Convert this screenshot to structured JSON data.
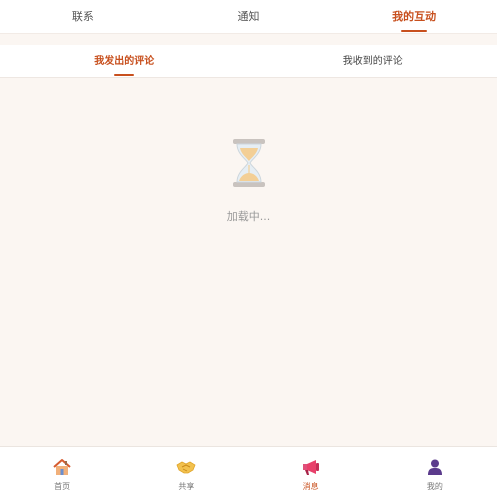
{
  "top_tabs": [
    {
      "label": "联系"
    },
    {
      "label": "通知"
    },
    {
      "label": "我的互动"
    }
  ],
  "sub_tabs": [
    {
      "label": "我发出的评论"
    },
    {
      "label": "我收到的评论"
    }
  ],
  "loading": {
    "text": "加载中..."
  },
  "bottom_nav": [
    {
      "label": "首页",
      "icon": "house-icon"
    },
    {
      "label": "共享",
      "icon": "handshake-icon"
    },
    {
      "label": "消息",
      "icon": "megaphone-icon"
    },
    {
      "label": "我的",
      "icon": "user-icon"
    }
  ],
  "colors": {
    "accent": "#c8501e",
    "background": "#fbf6f2"
  }
}
